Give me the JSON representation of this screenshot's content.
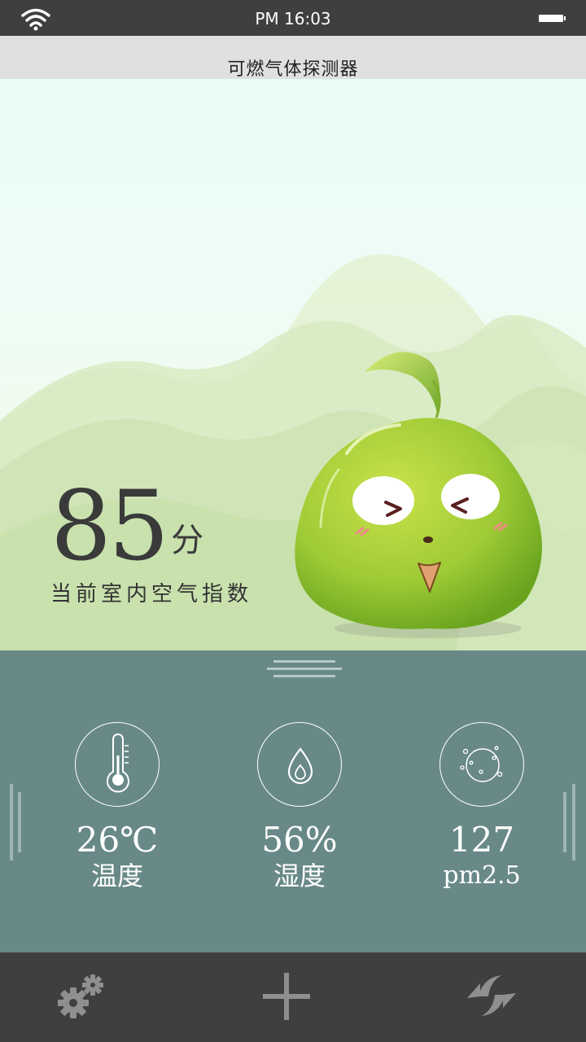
{
  "status_bar": {
    "time": "PM 16:03",
    "wifi_icon": "wifi-icon",
    "battery_icon": "battery-icon"
  },
  "header": {
    "title": "可燃气体探测器"
  },
  "score": {
    "value": "85",
    "unit": "分",
    "label": "当前室内空气指数"
  },
  "metrics": [
    {
      "icon": "thermometer-icon",
      "value": "26℃",
      "label": "温度"
    },
    {
      "icon": "water-drop-icon",
      "value": "56%",
      "label": "湿度"
    },
    {
      "icon": "particles-icon",
      "value": "127",
      "label": "pm2.5"
    }
  ],
  "tabbar": {
    "items": [
      {
        "icon": "settings-gears-icon"
      },
      {
        "icon": "add-plus-icon"
      },
      {
        "icon": "refresh-arrows-icon"
      }
    ]
  },
  "colors": {
    "panel": "#688987",
    "bars": "#3f3f3f",
    "title_bar": "#e0e0e0",
    "mascot": "#a6cf3a"
  }
}
